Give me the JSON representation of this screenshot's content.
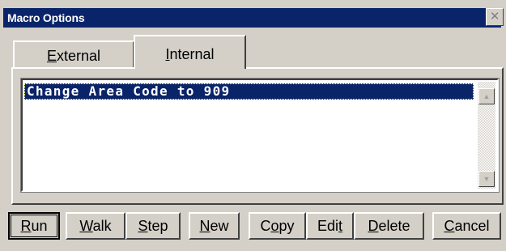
{
  "window": {
    "title": "Macro Options",
    "close_glyph": "✕"
  },
  "tabs": [
    {
      "pre": "",
      "mnemonic": "E",
      "rest": "xternal",
      "active": false
    },
    {
      "pre": "",
      "mnemonic": "I",
      "rest": "nternal",
      "active": true
    }
  ],
  "macro_list": {
    "items": [
      {
        "label": "Change Area Code to 909",
        "selected": true
      }
    ]
  },
  "scrollbar": {
    "up_icon": "▲",
    "down_icon": "▼"
  },
  "buttons": [
    {
      "id": "run",
      "pre": "",
      "mnemonic": "R",
      "rest": "un"
    },
    {
      "id": "walk",
      "pre": "",
      "mnemonic": "W",
      "rest": "alk"
    },
    {
      "id": "step",
      "pre": "",
      "mnemonic": "S",
      "rest": "tep"
    },
    {
      "id": "new",
      "pre": "",
      "mnemonic": "N",
      "rest": "ew"
    },
    {
      "id": "copy",
      "pre": "C",
      "mnemonic": "o",
      "rest": "py"
    },
    {
      "id": "edit",
      "pre": "Edi",
      "mnemonic": "t",
      "rest": ""
    },
    {
      "id": "delete",
      "pre": "",
      "mnemonic": "D",
      "rest": "elete"
    },
    {
      "id": "cancel",
      "pre": "",
      "mnemonic": "C",
      "rest": "ancel"
    }
  ]
}
